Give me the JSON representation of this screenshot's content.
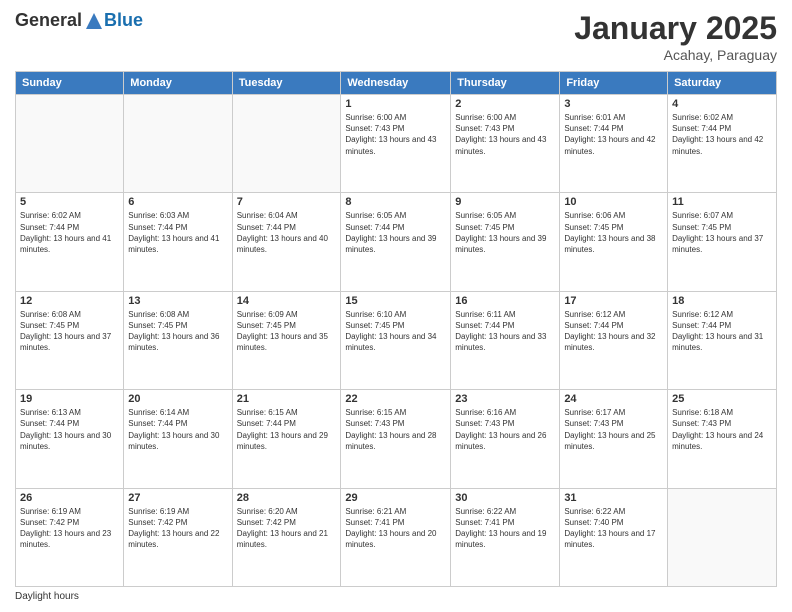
{
  "header": {
    "logo_general": "General",
    "logo_blue": "Blue",
    "month_title": "January 2025",
    "location": "Acahay, Paraguay"
  },
  "days_of_week": [
    "Sunday",
    "Monday",
    "Tuesday",
    "Wednesday",
    "Thursday",
    "Friday",
    "Saturday"
  ],
  "footer": {
    "daylight_hours_label": "Daylight hours"
  },
  "weeks": [
    [
      {
        "day": "",
        "sunrise": "",
        "sunset": "",
        "daylight": "",
        "empty": true
      },
      {
        "day": "",
        "sunrise": "",
        "sunset": "",
        "daylight": "",
        "empty": true
      },
      {
        "day": "",
        "sunrise": "",
        "sunset": "",
        "daylight": "",
        "empty": true
      },
      {
        "day": "1",
        "sunrise": "Sunrise: 6:00 AM",
        "sunset": "Sunset: 7:43 PM",
        "daylight": "Daylight: 13 hours and 43 minutes."
      },
      {
        "day": "2",
        "sunrise": "Sunrise: 6:00 AM",
        "sunset": "Sunset: 7:43 PM",
        "daylight": "Daylight: 13 hours and 43 minutes."
      },
      {
        "day": "3",
        "sunrise": "Sunrise: 6:01 AM",
        "sunset": "Sunset: 7:44 PM",
        "daylight": "Daylight: 13 hours and 42 minutes."
      },
      {
        "day": "4",
        "sunrise": "Sunrise: 6:02 AM",
        "sunset": "Sunset: 7:44 PM",
        "daylight": "Daylight: 13 hours and 42 minutes."
      }
    ],
    [
      {
        "day": "5",
        "sunrise": "Sunrise: 6:02 AM",
        "sunset": "Sunset: 7:44 PM",
        "daylight": "Daylight: 13 hours and 41 minutes."
      },
      {
        "day": "6",
        "sunrise": "Sunrise: 6:03 AM",
        "sunset": "Sunset: 7:44 PM",
        "daylight": "Daylight: 13 hours and 41 minutes."
      },
      {
        "day": "7",
        "sunrise": "Sunrise: 6:04 AM",
        "sunset": "Sunset: 7:44 PM",
        "daylight": "Daylight: 13 hours and 40 minutes."
      },
      {
        "day": "8",
        "sunrise": "Sunrise: 6:05 AM",
        "sunset": "Sunset: 7:44 PM",
        "daylight": "Daylight: 13 hours and 39 minutes."
      },
      {
        "day": "9",
        "sunrise": "Sunrise: 6:05 AM",
        "sunset": "Sunset: 7:45 PM",
        "daylight": "Daylight: 13 hours and 39 minutes."
      },
      {
        "day": "10",
        "sunrise": "Sunrise: 6:06 AM",
        "sunset": "Sunset: 7:45 PM",
        "daylight": "Daylight: 13 hours and 38 minutes."
      },
      {
        "day": "11",
        "sunrise": "Sunrise: 6:07 AM",
        "sunset": "Sunset: 7:45 PM",
        "daylight": "Daylight: 13 hours and 37 minutes."
      }
    ],
    [
      {
        "day": "12",
        "sunrise": "Sunrise: 6:08 AM",
        "sunset": "Sunset: 7:45 PM",
        "daylight": "Daylight: 13 hours and 37 minutes."
      },
      {
        "day": "13",
        "sunrise": "Sunrise: 6:08 AM",
        "sunset": "Sunset: 7:45 PM",
        "daylight": "Daylight: 13 hours and 36 minutes."
      },
      {
        "day": "14",
        "sunrise": "Sunrise: 6:09 AM",
        "sunset": "Sunset: 7:45 PM",
        "daylight": "Daylight: 13 hours and 35 minutes."
      },
      {
        "day": "15",
        "sunrise": "Sunrise: 6:10 AM",
        "sunset": "Sunset: 7:45 PM",
        "daylight": "Daylight: 13 hours and 34 minutes."
      },
      {
        "day": "16",
        "sunrise": "Sunrise: 6:11 AM",
        "sunset": "Sunset: 7:44 PM",
        "daylight": "Daylight: 13 hours and 33 minutes."
      },
      {
        "day": "17",
        "sunrise": "Sunrise: 6:12 AM",
        "sunset": "Sunset: 7:44 PM",
        "daylight": "Daylight: 13 hours and 32 minutes."
      },
      {
        "day": "18",
        "sunrise": "Sunrise: 6:12 AM",
        "sunset": "Sunset: 7:44 PM",
        "daylight": "Daylight: 13 hours and 31 minutes."
      }
    ],
    [
      {
        "day": "19",
        "sunrise": "Sunrise: 6:13 AM",
        "sunset": "Sunset: 7:44 PM",
        "daylight": "Daylight: 13 hours and 30 minutes."
      },
      {
        "day": "20",
        "sunrise": "Sunrise: 6:14 AM",
        "sunset": "Sunset: 7:44 PM",
        "daylight": "Daylight: 13 hours and 30 minutes."
      },
      {
        "day": "21",
        "sunrise": "Sunrise: 6:15 AM",
        "sunset": "Sunset: 7:44 PM",
        "daylight": "Daylight: 13 hours and 29 minutes."
      },
      {
        "day": "22",
        "sunrise": "Sunrise: 6:15 AM",
        "sunset": "Sunset: 7:43 PM",
        "daylight": "Daylight: 13 hours and 28 minutes."
      },
      {
        "day": "23",
        "sunrise": "Sunrise: 6:16 AM",
        "sunset": "Sunset: 7:43 PM",
        "daylight": "Daylight: 13 hours and 26 minutes."
      },
      {
        "day": "24",
        "sunrise": "Sunrise: 6:17 AM",
        "sunset": "Sunset: 7:43 PM",
        "daylight": "Daylight: 13 hours and 25 minutes."
      },
      {
        "day": "25",
        "sunrise": "Sunrise: 6:18 AM",
        "sunset": "Sunset: 7:43 PM",
        "daylight": "Daylight: 13 hours and 24 minutes."
      }
    ],
    [
      {
        "day": "26",
        "sunrise": "Sunrise: 6:19 AM",
        "sunset": "Sunset: 7:42 PM",
        "daylight": "Daylight: 13 hours and 23 minutes."
      },
      {
        "day": "27",
        "sunrise": "Sunrise: 6:19 AM",
        "sunset": "Sunset: 7:42 PM",
        "daylight": "Daylight: 13 hours and 22 minutes."
      },
      {
        "day": "28",
        "sunrise": "Sunrise: 6:20 AM",
        "sunset": "Sunset: 7:42 PM",
        "daylight": "Daylight: 13 hours and 21 minutes."
      },
      {
        "day": "29",
        "sunrise": "Sunrise: 6:21 AM",
        "sunset": "Sunset: 7:41 PM",
        "daylight": "Daylight: 13 hours and 20 minutes."
      },
      {
        "day": "30",
        "sunrise": "Sunrise: 6:22 AM",
        "sunset": "Sunset: 7:41 PM",
        "daylight": "Daylight: 13 hours and 19 minutes."
      },
      {
        "day": "31",
        "sunrise": "Sunrise: 6:22 AM",
        "sunset": "Sunset: 7:40 PM",
        "daylight": "Daylight: 13 hours and 17 minutes."
      },
      {
        "day": "",
        "sunrise": "",
        "sunset": "",
        "daylight": "",
        "empty": true
      }
    ]
  ]
}
